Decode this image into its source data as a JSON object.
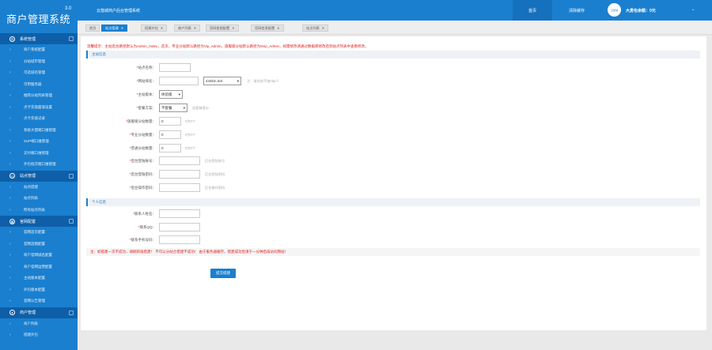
{
  "brand": {
    "title": "商户管理系统",
    "version": "3.0"
  },
  "sidebar": {
    "groups": [
      {
        "label": "系统管理",
        "icon": "gear-icon",
        "items": [
          "商户系统配置",
          "分站城市管理",
          "可选城名管理",
          "可用服务器",
          "推荐分站列表管理",
          "点卡充值面值设置",
          "点卡充值记录",
          "系统大盟端口维管理",
          "SUP端口维管理",
          "支付端口维管理",
          "外包批次端口维管理"
        ]
      },
      {
        "label": "站点管理",
        "icon": "monitor-icon",
        "items": [
          "站点搭建",
          "站点列表",
          "所有站点列表"
        ]
      },
      {
        "label": "官网配置",
        "icon": "grid-icon",
        "items": [
          "官网首页配置",
          "官网首图配置",
          "商户官网城名配置",
          "商户官网运营配置",
          "主站版本配置",
          "外包版本配置",
          "官网公告管理"
        ]
      },
      {
        "label": "商户管理",
        "icon": "user-icon",
        "items": [
          "商户列表",
          "搭建外包"
        ]
      }
    ]
  },
  "header": {
    "title": "云悠城商户后台管理系统",
    "nav_home": "首页",
    "nav_cache": "清除缓存",
    "avatar_text": "云悠城",
    "user_info": "大勇包余额：0元",
    "caret": "⌄"
  },
  "tabs": [
    {
      "label": "首页",
      "closable": false,
      "active": false
    },
    {
      "label": "站点搭建",
      "closable": true,
      "active": true
    },
    {
      "label": "搭建外包",
      "closable": true,
      "active": false
    },
    {
      "label": "商户列表",
      "closable": true,
      "active": false
    },
    {
      "label": "官网首图配置",
      "closable": true,
      "active": false
    },
    {
      "label": "官网信息配置",
      "closable": true,
      "active": false
    },
    {
      "label": "站点列表",
      "closable": true,
      "active": false
    }
  ],
  "form": {
    "notice": "温馨提示：主站后台路径默认为Admin_Index，首页、专业分站默认路径为Vip_Admin，旗舰版分站默认路径为Svip_Admin，如需修改请通过数据库修改后到站点列表中查看修改。",
    "section_main": "主站信息",
    "section_personal": "个人信息",
    "site_name_label": "*站点名称：",
    "domain_label": "*网站域名：",
    "domain_suffix": "444km.net",
    "domain_hint": "注：域名前不加http://",
    "version_label": "*主站版本：",
    "version_value": "体验版",
    "package_label": "*套餐方案：",
    "package_value": "不套餐",
    "package_hint": "选套餐提示",
    "flagship_label": "*旗舰版分站数量：",
    "flagship_value": "0",
    "flagship_hint": "0为0个",
    "pro_label": "*专业分站数量：",
    "pro_value": "0",
    "pro_hint": "0为0个",
    "basic_label": "*普通分站数量：",
    "basic_value": "0",
    "basic_hint": "0为0个",
    "admin_user_label": "*后台登陆账号：",
    "admin_user_hint": "后台登陆账号",
    "admin_pass_label": "*后台登陆密码：",
    "admin_pass_hint": "后台登陆密码",
    "admin_op_label": "*后台操作密码：",
    "admin_op_hint": "后台操作密码",
    "contact_name_label": "*联系人姓名：",
    "contact_qq_label": "*联系QQ：",
    "contact_phone_label": "*联系手机号码：",
    "warning": "注：如搭建一次不成功，请刷新再搭建！ 不可以分站仓搭建不成功！ 由于服务器缓存，搭建成功后请于一分钟后再访问网站！",
    "submit_label": "提交搭建"
  },
  "colors": {
    "brand_blue": "#1a7fcf",
    "dark_blue": "#0e5fa8",
    "danger_red": "#e02020"
  }
}
